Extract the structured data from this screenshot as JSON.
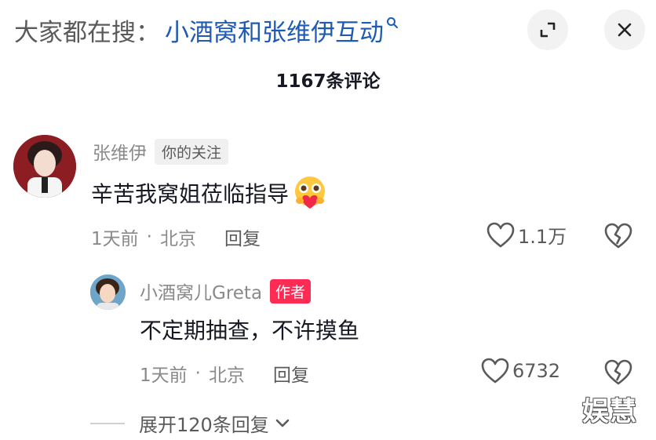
{
  "search": {
    "prefix": "大家都在搜：",
    "query": "小酒窝和张维伊互动"
  },
  "header": {
    "comment_count": "1167条评论"
  },
  "comments": [
    {
      "username": "张维伊",
      "tag": "你的关注",
      "text": "辛苦我窝姐莅临指导",
      "emoji": "heart-hug-emoji",
      "time": "1天前",
      "location": "北京",
      "reply_label": "回复",
      "likes": "1.1万"
    }
  ],
  "replies": [
    {
      "username": "小酒窝儿Greta",
      "tag": "作者",
      "text": "不定期抽查，不许摸鱼",
      "time": "1天前",
      "location": "北京",
      "reply_label": "回复",
      "likes": "6732"
    }
  ],
  "expand_replies_label": "展开120条回复",
  "watermark": "娱慧",
  "colors": {
    "query_blue": "#1f5bb3",
    "author_tag": "#fe2c55",
    "muted_text": "#8a8a8a"
  },
  "icons": [
    "search-icon",
    "expand-icon",
    "close-icon",
    "heart-icon",
    "broken-heart-icon",
    "chevron-down-icon"
  ]
}
